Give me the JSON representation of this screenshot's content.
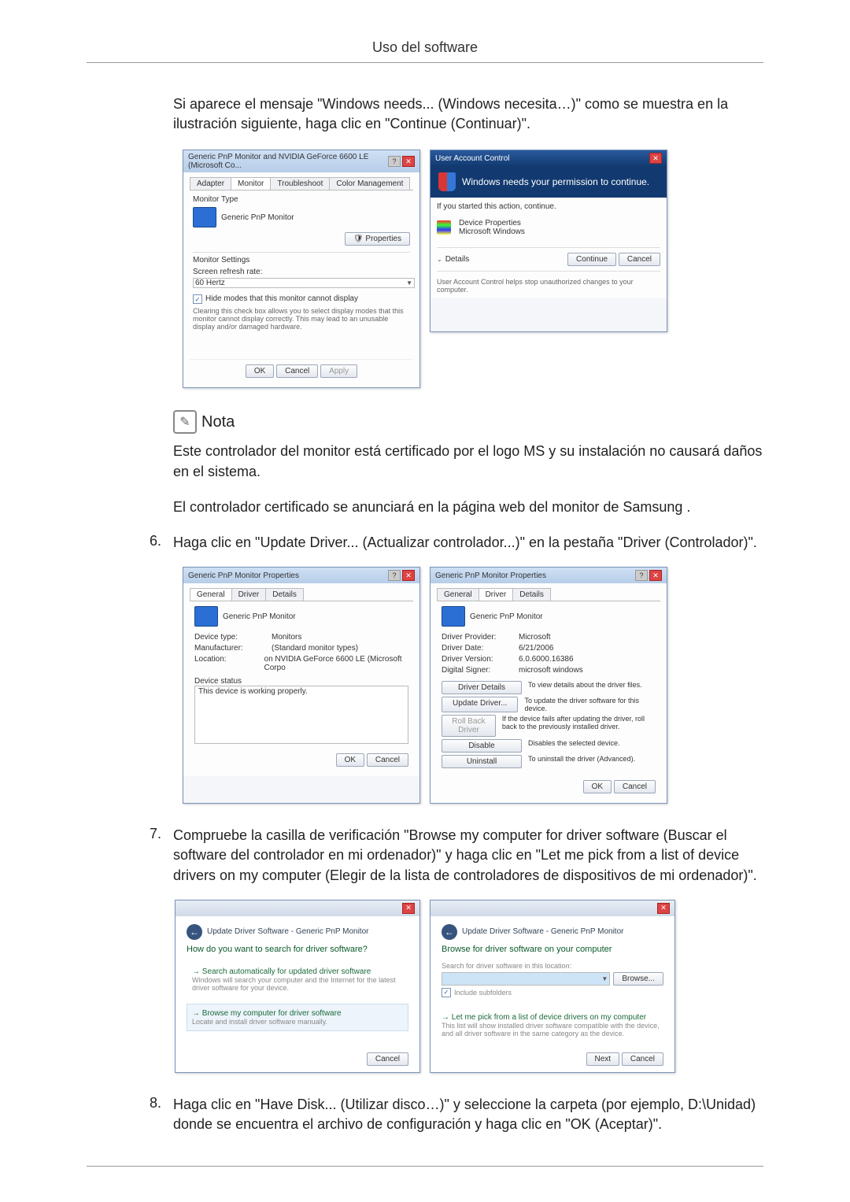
{
  "header": {
    "title": "Uso del software"
  },
  "intro": {
    "para1": "Si aparece el mensaje \"Windows needs... (Windows necesita…)\" como se muestra en la ilustración siguiente, haga clic en \"Continue (Continuar)\"."
  },
  "fig1": {
    "monitor_dialog": {
      "title": "Generic PnP Monitor and NVIDIA GeForce 6600 LE (Microsoft Co...",
      "tabs": {
        "adapter": "Adapter",
        "monitor": "Monitor",
        "troubleshoot": "Troubleshoot",
        "color": "Color Management"
      },
      "monitor_type_label": "Monitor Type",
      "monitor_name": "Generic PnP Monitor",
      "properties_btn": "Properties",
      "settings_label": "Monitor Settings",
      "refresh_label": "Screen refresh rate:",
      "refresh_value": "60 Hertz",
      "hide_modes_check": "Hide modes that this monitor cannot display",
      "hide_modes_desc": "Clearing this check box allows you to select display modes that this monitor cannot display correctly. This may lead to an unusable display and/or damaged hardware.",
      "ok": "OK",
      "cancel": "Cancel",
      "apply": "Apply"
    },
    "uac_dialog": {
      "title": "User Account Control",
      "headline": "Windows needs your permission to continue.",
      "started": "If you started this action, continue.",
      "device_props": "Device Properties",
      "ms_windows": "Microsoft Windows",
      "details": "Details",
      "continue": "Continue",
      "cancel": "Cancel",
      "footer": "User Account Control helps stop unauthorized changes to your computer."
    }
  },
  "note": {
    "label": "Nota",
    "p1": "Este controlador del monitor está certificado por el logo MS y su instalación no causará daños en el sistema.",
    "p2": "El controlador certificado se anunciará en la página web del monitor de Samsung ."
  },
  "step6": {
    "num": "6.",
    "text": "Haga clic en \"Update Driver... (Actualizar controlador...)\" en la pestaña \"Driver (Controlador)\"."
  },
  "fig2": {
    "general_dialog": {
      "title": "Generic PnP Monitor Properties",
      "tabs": {
        "general": "General",
        "driver": "Driver",
        "details": "Details"
      },
      "name": "Generic PnP Monitor",
      "device_type_l": "Device type:",
      "device_type_v": "Monitors",
      "manufacturer_l": "Manufacturer:",
      "manufacturer_v": "(Standard monitor types)",
      "location_l": "Location:",
      "location_v": "on NVIDIA GeForce 6600 LE (Microsoft Corpo",
      "status_l": "Device status",
      "status_v": "This device is working properly.",
      "ok": "OK",
      "cancel": "Cancel"
    },
    "driver_dialog": {
      "title": "Generic PnP Monitor Properties",
      "tabs": {
        "general": "General",
        "driver": "Driver",
        "details": "Details"
      },
      "name": "Generic PnP Monitor",
      "provider_l": "Driver Provider:",
      "provider_v": "Microsoft",
      "date_l": "Driver Date:",
      "date_v": "6/21/2006",
      "version_l": "Driver Version:",
      "version_v": "6.0.6000.16386",
      "signer_l": "Digital Signer:",
      "signer_v": "microsoft windows",
      "btn_details": "Driver Details",
      "btn_details_desc": "To view details about the driver files.",
      "btn_update": "Update Driver...",
      "btn_update_desc": "To update the driver software for this device.",
      "btn_rollback": "Roll Back Driver",
      "btn_rollback_desc": "If the device fails after updating the driver, roll back to the previously installed driver.",
      "btn_disable": "Disable",
      "btn_disable_desc": "Disables the selected device.",
      "btn_uninstall": "Uninstall",
      "btn_uninstall_desc": "To uninstall the driver (Advanced).",
      "ok": "OK",
      "cancel": "Cancel"
    }
  },
  "step7": {
    "num": "7.",
    "text": "Compruebe la casilla de verificación \"Browse my computer for driver software (Buscar el software del controlador en mi ordenador)\" y haga clic en \"Let me pick from a list of device drivers on my computer (Elegir de la lista de controladores de dispositivos de mi ordenador)\"."
  },
  "fig3": {
    "wiz1": {
      "title": "Update Driver Software - Generic PnP Monitor",
      "heading": "How do you want to search for driver software?",
      "opt1": "Search automatically for updated driver software",
      "opt1_desc": "Windows will search your computer and the Internet for the latest driver software for your device.",
      "opt2": "Browse my computer for driver software",
      "opt2_desc": "Locate and install driver software manually.",
      "cancel": "Cancel"
    },
    "wiz2": {
      "title": "Update Driver Software - Generic PnP Monitor",
      "heading": "Browse for driver software on your computer",
      "search_label": "Search for driver software in this location:",
      "browse_btn": "Browse...",
      "include_sub": "Include subfolders",
      "pick": "Let me pick from a list of device drivers on my computer",
      "pick_desc": "This list will show installed driver software compatible with the device, and all driver software in the same category as the device.",
      "next": "Next",
      "cancel": "Cancel"
    }
  },
  "step8": {
    "num": "8.",
    "text": "Haga clic en \"Have Disk... (Utilizar disco…)\" y seleccione la carpeta (por ejemplo, D:\\Unidad) donde se encuentra el archivo de configuración y haga clic en \"OK (Aceptar)\"."
  }
}
